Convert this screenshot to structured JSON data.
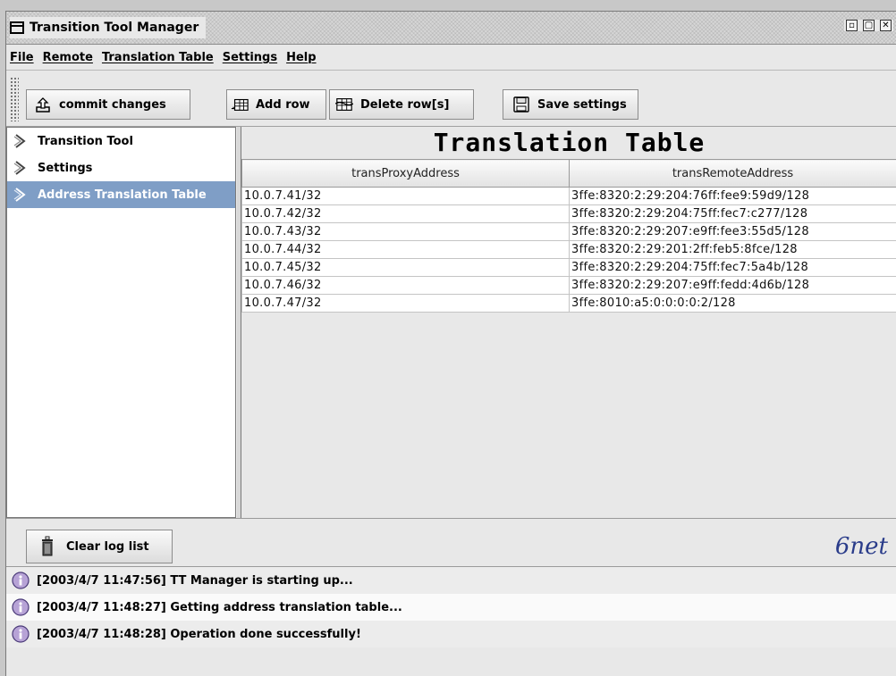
{
  "window": {
    "title": "Transition Tool Manager"
  },
  "menu": [
    "File",
    "Remote",
    "Translation Table",
    "Settings",
    "Help"
  ],
  "toolbar": {
    "commit": "commit changes",
    "add_row": "Add row",
    "delete_row": "Delete row[s]",
    "save_settings": "Save settings"
  },
  "tree": [
    "Transition Tool",
    "Settings",
    "Address Translation Table"
  ],
  "tree_selected": "Address Translation Table",
  "table": {
    "title": "Translation Table",
    "columns": [
      "transProxyAddress",
      "transRemoteAddress"
    ],
    "rows": [
      [
        "10.0.7.41/32",
        "3ffe:8320:2:29:204:76ff:fee9:59d9/128"
      ],
      [
        "10.0.7.42/32",
        "3ffe:8320:2:29:204:75ff:fec7:c277/128"
      ],
      [
        "10.0.7.43/32",
        "3ffe:8320:2:29:207:e9ff:fee3:55d5/128"
      ],
      [
        "10.0.7.44/32",
        "3ffe:8320:2:29:201:2ff:feb5:8fce/128"
      ],
      [
        "10.0.7.45/32",
        "3ffe:8320:2:29:204:75ff:fec7:5a4b/128"
      ],
      [
        "10.0.7.46/32",
        "3ffe:8320:2:29:207:e9ff:fedd:4d6b/128"
      ],
      [
        "10.0.7.47/32",
        "3ffe:8010:a5:0:0:0:0:2/128"
      ]
    ]
  },
  "log": {
    "clear_label": "Clear log list",
    "brand": "6net",
    "entries": [
      "[2003/4/7  11:47:56] TT Manager is starting up...",
      "[2003/4/7  11:48:27] Getting address translation table...",
      "[2003/4/7  11:48:28] Operation done successfully!"
    ]
  },
  "colors": {
    "selection": "#7f9ec6",
    "brand": "#2a3c8a"
  }
}
